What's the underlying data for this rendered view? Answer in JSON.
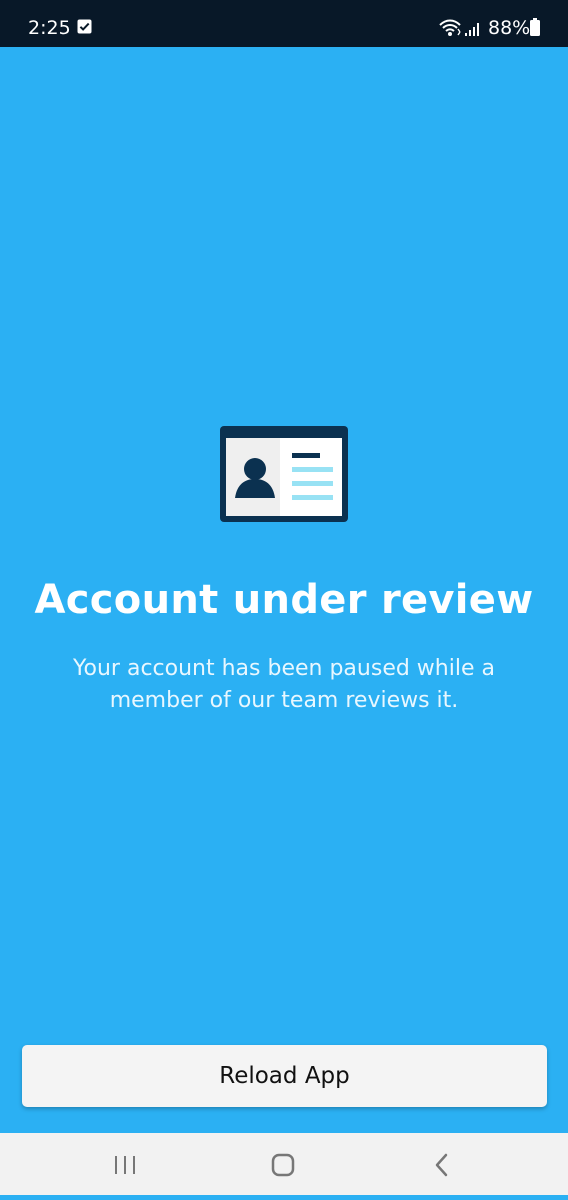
{
  "status_bar": {
    "time": "2:25",
    "battery": "88%",
    "icons": [
      "clipboard-check-icon",
      "wifi-icon",
      "signal-icon",
      "battery-icon"
    ]
  },
  "main": {
    "icon": "id-card-icon",
    "title": "Account under review",
    "message": "Your account has been paused while a member of our team reviews it."
  },
  "actions": {
    "reload_label": "Reload App"
  },
  "navigation": {
    "icons": [
      "recent-apps-icon",
      "home-icon",
      "back-icon"
    ]
  },
  "colors": {
    "background": "#2bb0f3",
    "status_bar": "#081828",
    "button": "#f4f4f4",
    "text": "#ffffff"
  }
}
